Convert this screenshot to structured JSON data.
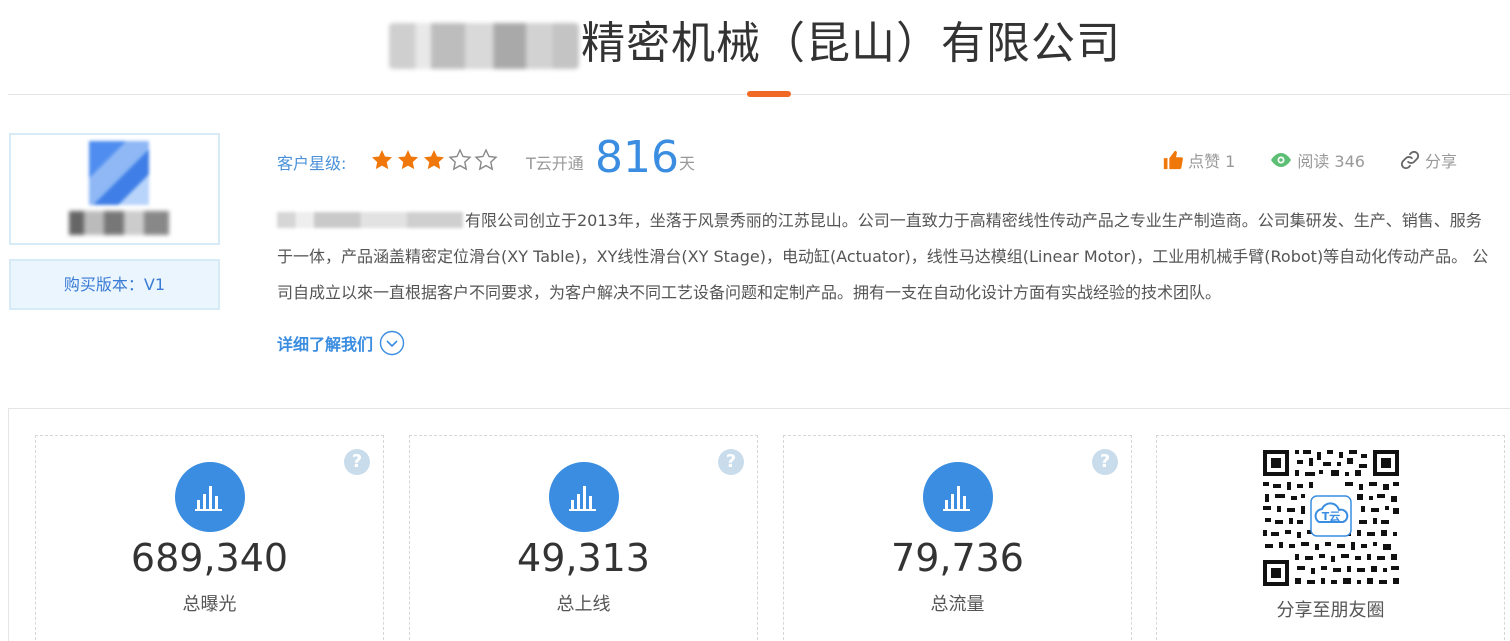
{
  "header": {
    "company_title": "精密机械（昆山）有限公司"
  },
  "profile": {
    "version_label": "购买版本：V1"
  },
  "rating": {
    "label": "客户星级:",
    "stars_filled": 3,
    "stars_total": 5,
    "open_label": "T云开通",
    "open_days": "816",
    "open_unit": "天"
  },
  "actions": {
    "like": "点赞 1",
    "read": "阅读 346",
    "share": "分享"
  },
  "description": {
    "text": "有限公司创立于2013年，坐落于风景秀丽的江苏昆山。公司一直致力于高精密线性传动产品之专业生产制造商。公司集研发、生产、销售、服务于一体，产品涵盖精密定位滑台(XY Table)，XY线性滑台(XY Stage)，电动缸(Actuator)，线性马达模组(Linear Motor)，工业用机械手臂(Robot)等自动化传动产品。 公司自成立以來一直根据客户不同要求，为客户解决不同工艺设备问题和定制产品。拥有一支在自动化设计方面有实战经验的技术团队。",
    "more_link": "详细了解我们"
  },
  "stats": [
    {
      "value": "689,340",
      "label": "总曝光"
    },
    {
      "value": "49,313",
      "label": "总上线"
    },
    {
      "value": "79,736",
      "label": "总流量"
    }
  ],
  "qr": {
    "label": "分享至朋友圈",
    "logo_text": "T云"
  },
  "colors": {
    "accent_blue": "#3a8de0",
    "accent_orange": "#f06a25",
    "star_orange": "#f0780a"
  },
  "help_glyph": "?"
}
